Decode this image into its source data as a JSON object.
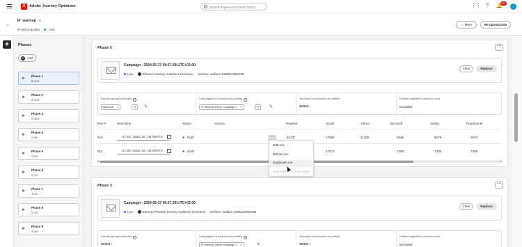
{
  "app": {
    "name": "Adobe Journey Optimizer",
    "logo_letter": "A",
    "accent_color": "#eb1000"
  },
  "search": {
    "placeholder": "Search Experience Cloud (Ctrl+/)"
  },
  "topbar": {
    "notification_count": "99+",
    "icons": [
      "apps-icon",
      "help-icon",
      "bell-icon"
    ]
  },
  "plan": {
    "title": "IP_warmup",
    "subtitle": "IP Warmup plan",
    "status": "Live",
    "more_label": "More",
    "reupload_label": "Re-upload plan"
  },
  "phases_panel": {
    "title": "Phases",
    "add_label": "Add",
    "items": [
      {
        "name": "Phase 1",
        "runs": "9 runs"
      },
      {
        "name": "Phase 2",
        "runs": "2 runs"
      },
      {
        "name": "Phase 3",
        "runs": "3 runs"
      },
      {
        "name": "Phase 4",
        "runs": "1 run"
      },
      {
        "name": "Phase 5",
        "runs": "1 run"
      },
      {
        "name": "Phase 6",
        "runs": "1 run"
      },
      {
        "name": "Phase 7",
        "runs": "1 run"
      },
      {
        "name": "Phase 8",
        "runs": "1 run"
      },
      {
        "name": "Phase 9",
        "runs": "1 run"
      }
    ]
  },
  "phase2": {
    "title": "Phase 2",
    "campaign": {
      "name": "Campaign - 2024-05-17 09:57:28 UTC+02:00",
      "status": "Live",
      "journey": "Phase3-Journey Audience Exclusion",
      "surface": "Surface: surface-1696512962186"
    },
    "clear_label": "Clear",
    "replace_label": "Replace",
    "exclusions": {
      "domain_label": "Domain groups excluded",
      "domain_tag": "Microsoft",
      "domain_more": "+1",
      "campaigns_label": "Campaigns for exclusion of profiles",
      "campaigns_tag": "IP Warmup Demo Campaign 1",
      "campaigns_more": "+1",
      "journeys_label": "Journeys for exclusion of profiles",
      "journeys_select": "Select",
      "profiles_label": "Profiles targeted in previous runs",
      "profiles_value": "Excluded"
    },
    "table": {
      "headers": [
        "Run #",
        "Send time",
        "Status",
        "Actions",
        "Targeted",
        "Gmail",
        "Yahoo",
        "Microsoft",
        "Adobe",
        "Roadrunner"
      ],
      "rows": [
        {
          "run": "#10",
          "send_time": "5 / 24 / 2024, 20 : 00  GMT+2",
          "status": "Draft",
          "targeted": "61337",
          "gmail": "17680",
          "yahoo": "21209",
          "microsoft": "5546",
          "adobe": "5678",
          "roadrunner": "5678"
        },
        {
          "run": "#11",
          "send_time": "5 / 30 / 2024, 20 : 30  GMT+2",
          "status": "Draft",
          "targeted": "22984",
          "gmail": "27571",
          "yahoo": "",
          "microsoft": "7209",
          "adobe": "7308",
          "roadrunner": "7308"
        }
      ]
    }
  },
  "actions_menu": {
    "items": [
      "Edit run",
      "Delete run",
      "Duplicate run",
      "Split runs to a new phase"
    ]
  },
  "phase3": {
    "title": "Phase 3",
    "campaign": {
      "name": "Campaign - 2024-05-17 09:57:28 UTC+02:00",
      "status": "Live",
      "journey": "warmup-Phase3-Journey Audience Exclusion",
      "surface": "Surface: surface-1696512962186"
    },
    "clear_label": "Clear",
    "replace_label": "Replace",
    "exclusions": {
      "domain_label": "Domain groups excluded",
      "domain_select": "Select",
      "campaigns_label": "Campaigns for exclusion of profiles",
      "campaigns_tag": "IP Warmup Demo Campaign 1",
      "journeys_label": "Journeys for exclusion of profiles",
      "journeys_select": "Select",
      "profiles_label": "Profiles targeted in previous runs",
      "profiles_value": "Excluded"
    }
  }
}
